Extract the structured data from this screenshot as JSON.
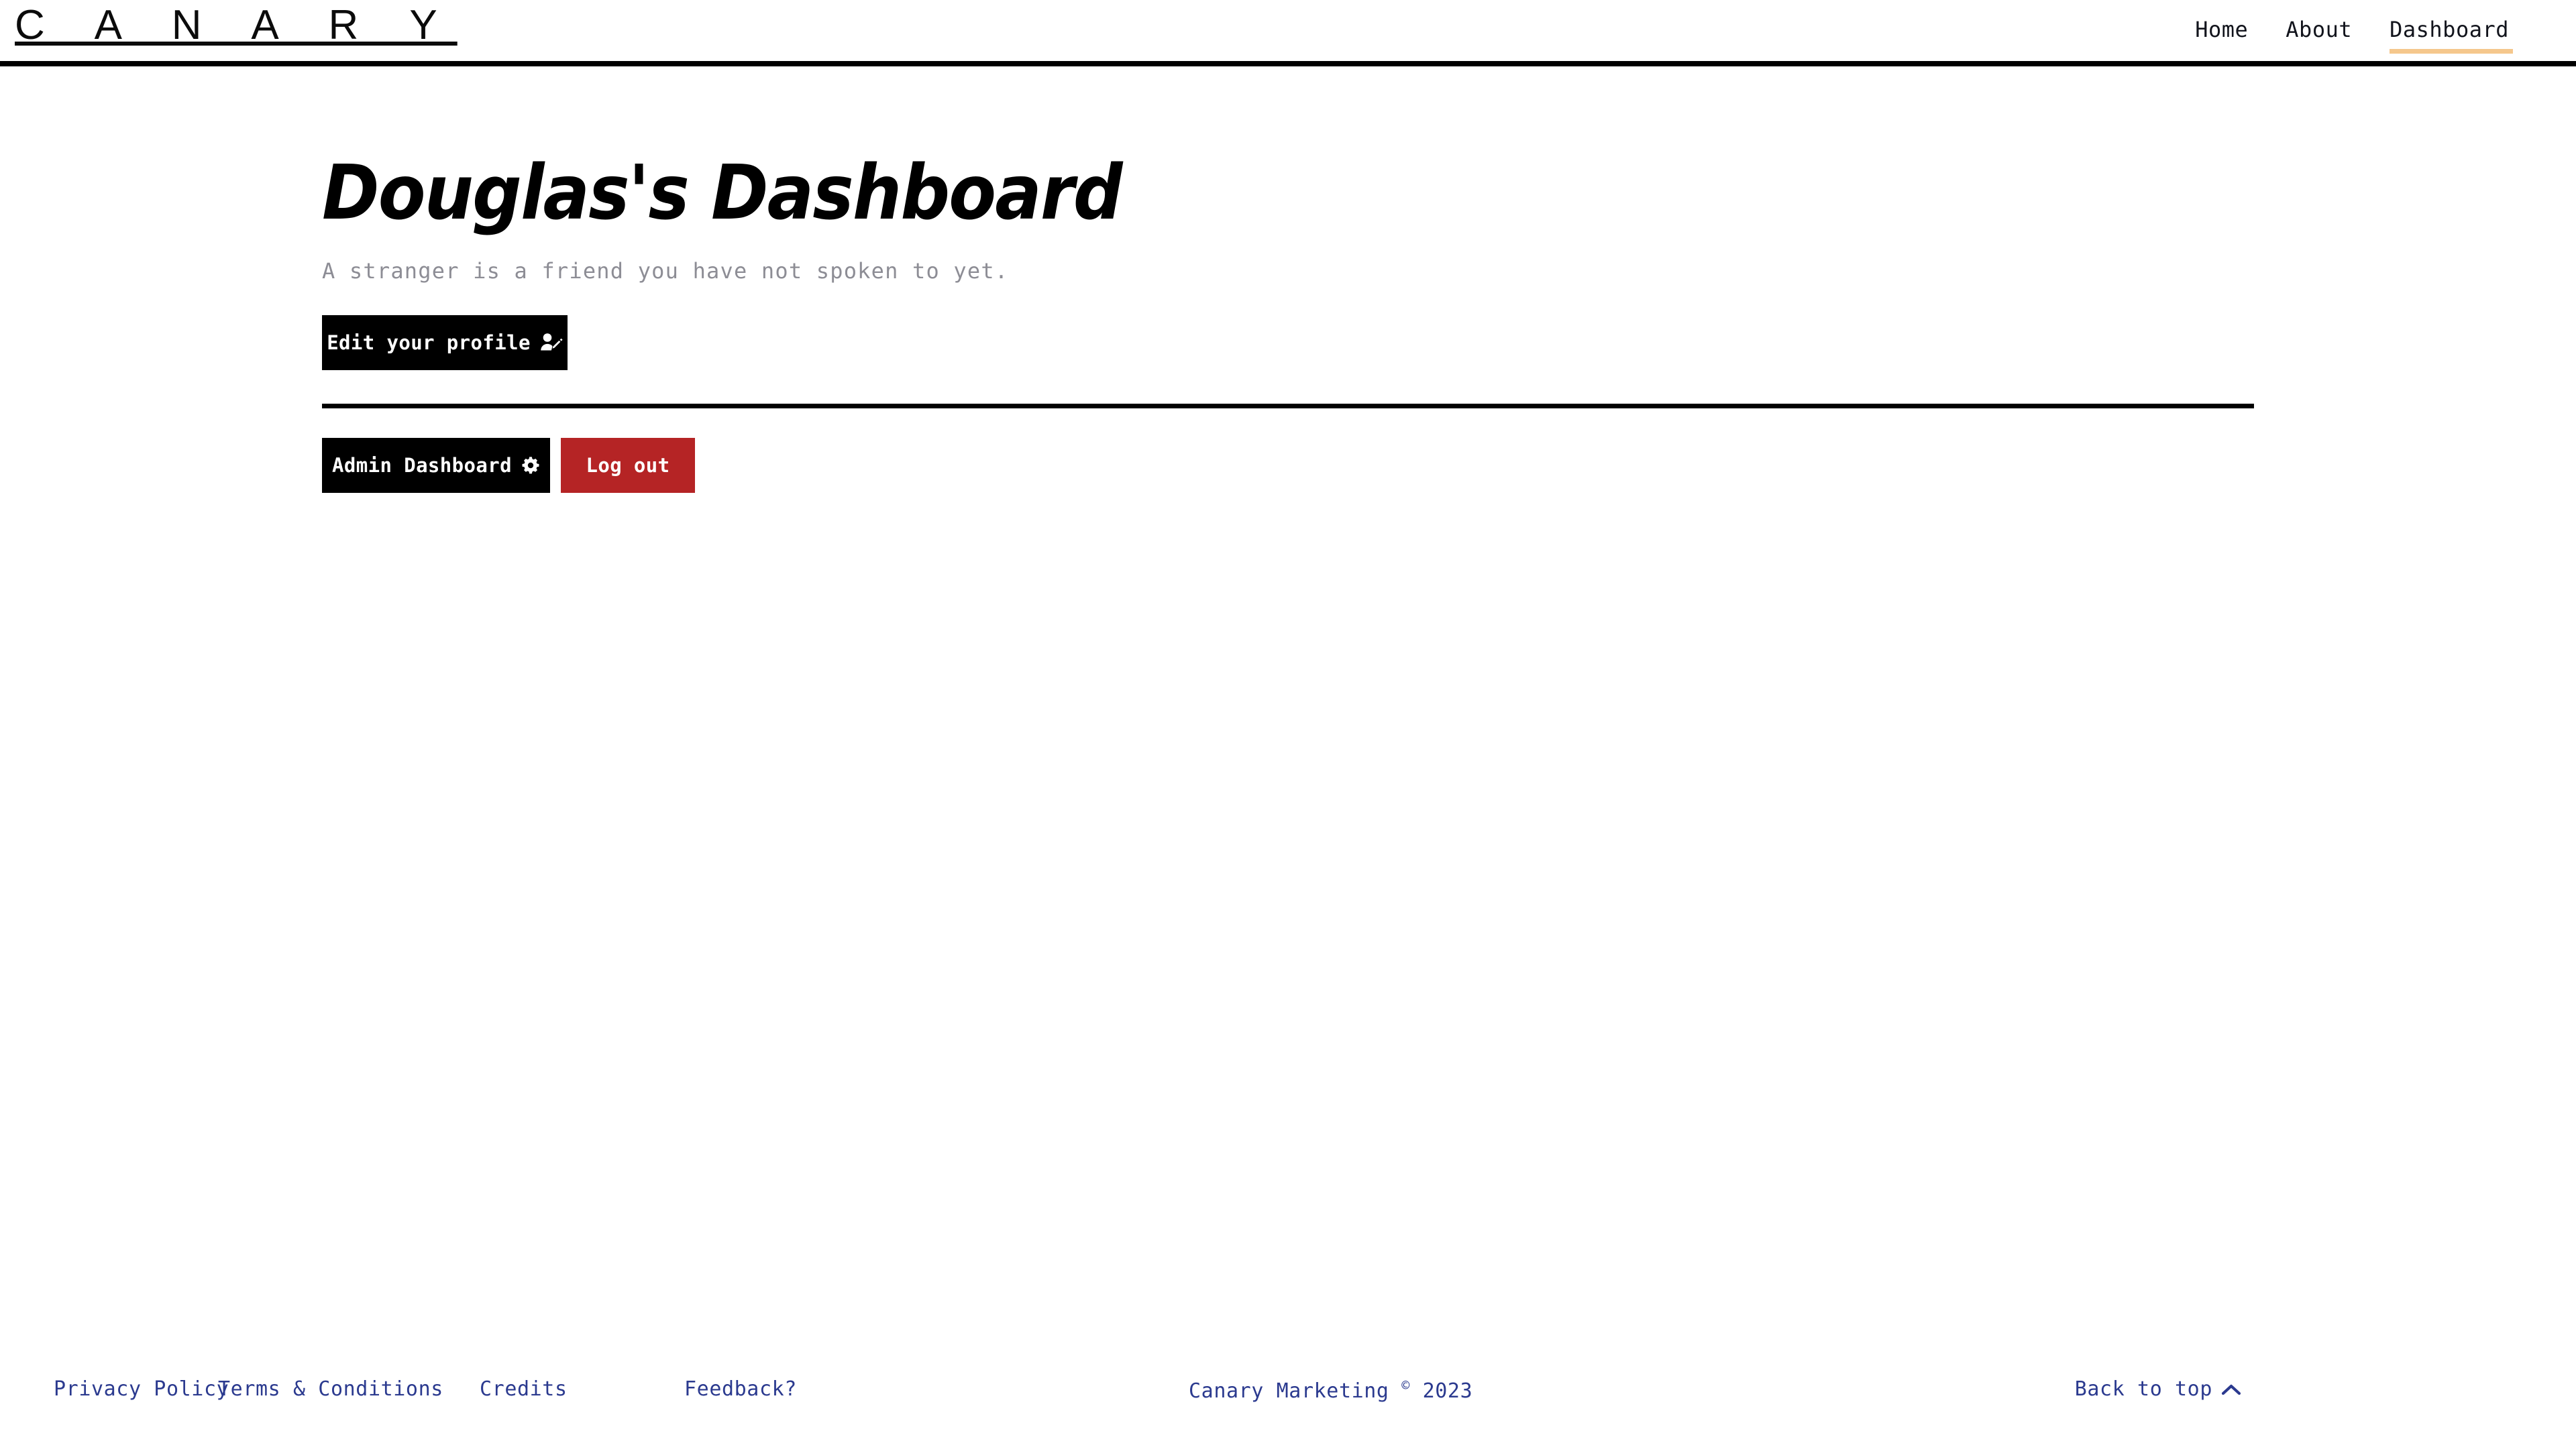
{
  "header": {
    "brand": "C A N A R Y",
    "nav": [
      {
        "label": "Home",
        "active": false
      },
      {
        "label": "About",
        "active": false
      },
      {
        "label": "Dashboard",
        "active": true
      }
    ],
    "active_underline_color": "#f5c78c",
    "border_color": "#000000"
  },
  "main": {
    "title": "Douglas's Dashboard",
    "tagline": "A stranger is a friend you have not spoken to yet.",
    "edit_profile_button": {
      "label": "Edit your profile",
      "icon": "user-edit-icon",
      "background": "#000000"
    },
    "admin_dashboard_button": {
      "label": "Admin Dashboard",
      "icon": "gear-icon",
      "background": "#000000"
    },
    "logout_button": {
      "label": "Log out",
      "background": "#b52425"
    }
  },
  "footer": {
    "links": [
      {
        "label": "Privacy Policy"
      },
      {
        "label": "Terms & Conditions"
      },
      {
        "label": "Credits"
      },
      {
        "label": "Feedback?"
      }
    ],
    "copyright_text": "Canary Marketing",
    "copyright_symbol": "©",
    "copyright_year": "2023",
    "back_to_top": {
      "label": "Back to top",
      "icon": "chevron-up-icon"
    },
    "link_color": "#2b3a8f"
  }
}
